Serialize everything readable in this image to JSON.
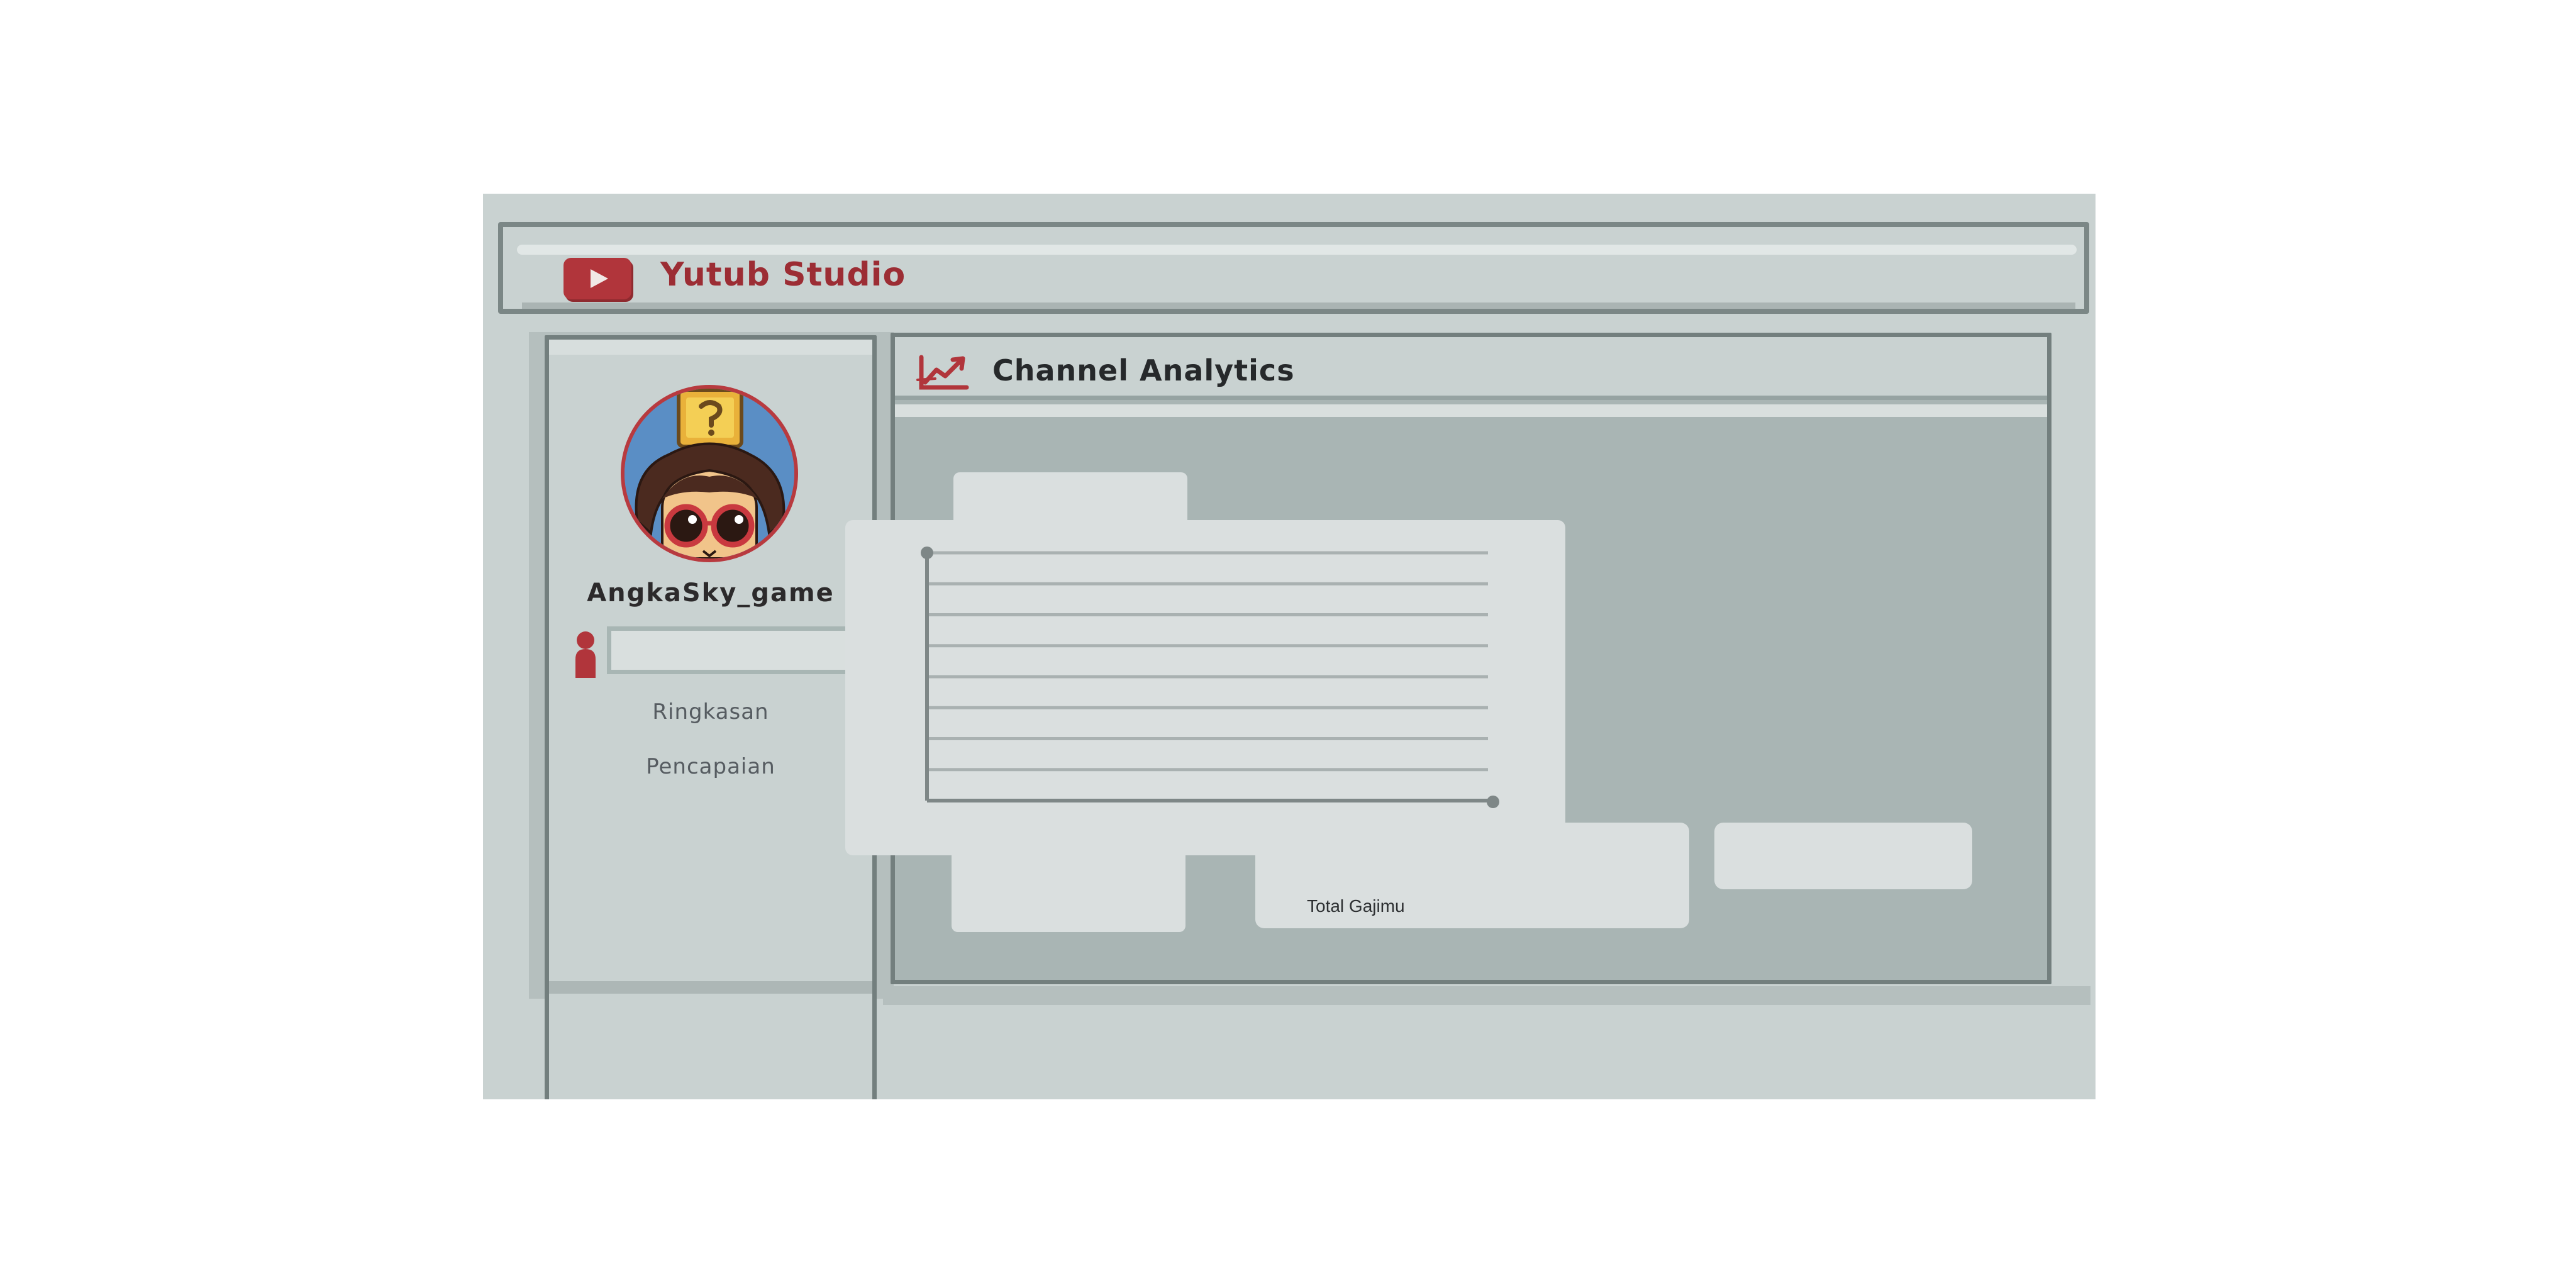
{
  "app": {
    "title": "Yutub Studio",
    "logo_icon": "play-button-icon"
  },
  "sidebar": {
    "channel_name": "AngkaSky_game",
    "subscriber_icon": "person-icon",
    "subscriber_value": "",
    "nav": [
      {
        "label": "Ringkasan"
      },
      {
        "label": "Pencapaian"
      }
    ]
  },
  "main": {
    "title": "Channel Analytics",
    "title_icon": "trend-chart-icon",
    "stat_cards": [
      "",
      "",
      ""
    ],
    "total_label": "Total Gajimu"
  },
  "colors": {
    "brand_red": "#b1353b",
    "title_red": "#9c2d34",
    "frame_bg": "#c9d2d1",
    "panel_bg": "#a9b5b4",
    "card_bg": "#dadfdf",
    "border": "#737f7e"
  },
  "chart_data": {
    "type": "line",
    "title": "",
    "xlabel": "",
    "ylabel": "",
    "series": [],
    "grid": true,
    "gridline_count": 8
  }
}
